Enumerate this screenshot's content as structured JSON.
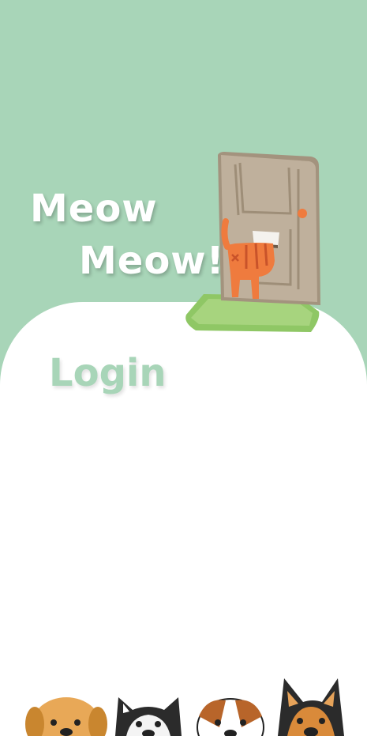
{
  "header": {
    "title_line1": "Meow",
    "title_line2": "Meow!"
  },
  "login": {
    "heading": "Login"
  },
  "colors": {
    "mint": "#a8d5b8",
    "door": "#bfb09c",
    "mat": "#8fc765",
    "cat": "#ef7b3e"
  },
  "illustrations": {
    "top": "cat-door-icon",
    "bottom": "dogs-icon"
  }
}
